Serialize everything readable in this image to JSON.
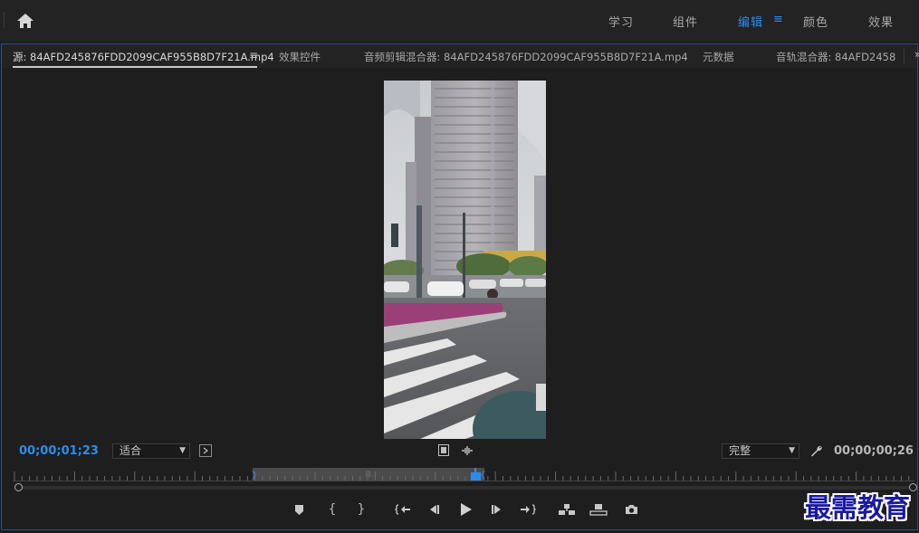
{
  "workspaces": {
    "items": [
      {
        "label": "学习",
        "active": false
      },
      {
        "label": "组件",
        "active": false
      },
      {
        "label": "编辑",
        "active": true
      },
      {
        "label": "颜色",
        "active": false
      },
      {
        "label": "效果",
        "active": false
      }
    ],
    "menu_glyph": "≡"
  },
  "tabs": {
    "source": "源: 84AFD245876FDD2099CAF955B8D7F21A.mp4",
    "effect_controls": "效果控件",
    "audio_clip_mixer": "音频剪辑混合器: 84AFD245876FDD2099CAF955B8D7F21A.mp4",
    "metadata": "元数据",
    "audio_track_mixer": "音轨混合器: 84AFD2458",
    "menu_glyph": "≡",
    "more_glyph": "»"
  },
  "source_monitor": {
    "current_timecode": "00;00;01;23",
    "fit_label": "适合",
    "quality_label": "完整",
    "duration_timecode": "00;00;00;26"
  },
  "controls": [
    "add-marker-icon",
    "mark-in-icon",
    "mark-out-icon",
    "go-to-in-icon",
    "step-back-icon",
    "play-icon",
    "step-forward-icon",
    "go-to-out-icon",
    "insert-icon",
    "overwrite-icon",
    "export-frame-icon"
  ],
  "colors": {
    "accent": "#2d8ceb",
    "panel_border": "#2a4e86",
    "watermark": "#1a1aa0"
  },
  "watermark": "最需教育"
}
